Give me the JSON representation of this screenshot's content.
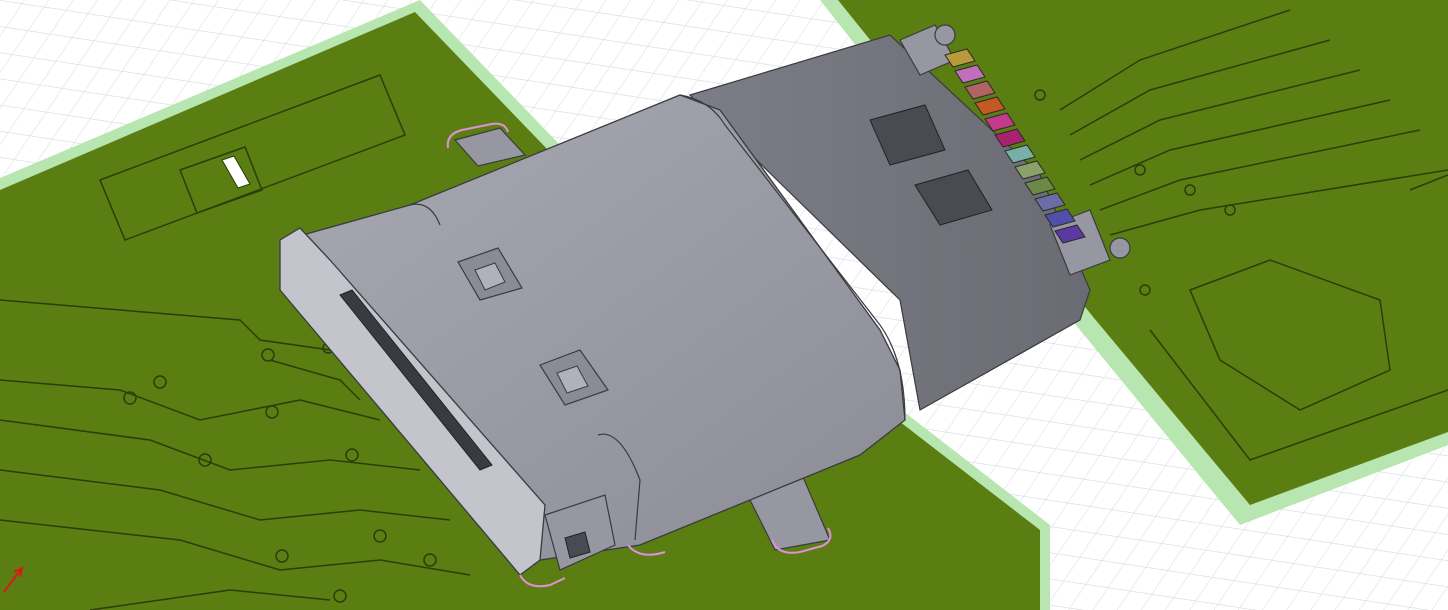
{
  "view": {
    "background_color": "#ffffff",
    "grid_color": "#cfd6dc",
    "board_color": "#5a7e12",
    "board_edge_color": "#b8e6b0",
    "trace_outline_color": "#2c3d08",
    "connector_shell_color": "#9697a0",
    "connector_dark_color": "#6f7078",
    "outline_highlight_color": "#e090d6",
    "triad_x_color": "#d81b1b"
  },
  "connector": {
    "pin_colors": [
      "#b89a3a",
      "#c070b8",
      "#b06464",
      "#c45a22",
      "#c23a8a",
      "#a82270",
      "#76b0a6",
      "#88a26a",
      "#6a8a46",
      "#6c6ca6",
      "#5050a8",
      "#5a3aa0"
    ]
  },
  "icons": {
    "triad": "axis-triad-icon"
  }
}
